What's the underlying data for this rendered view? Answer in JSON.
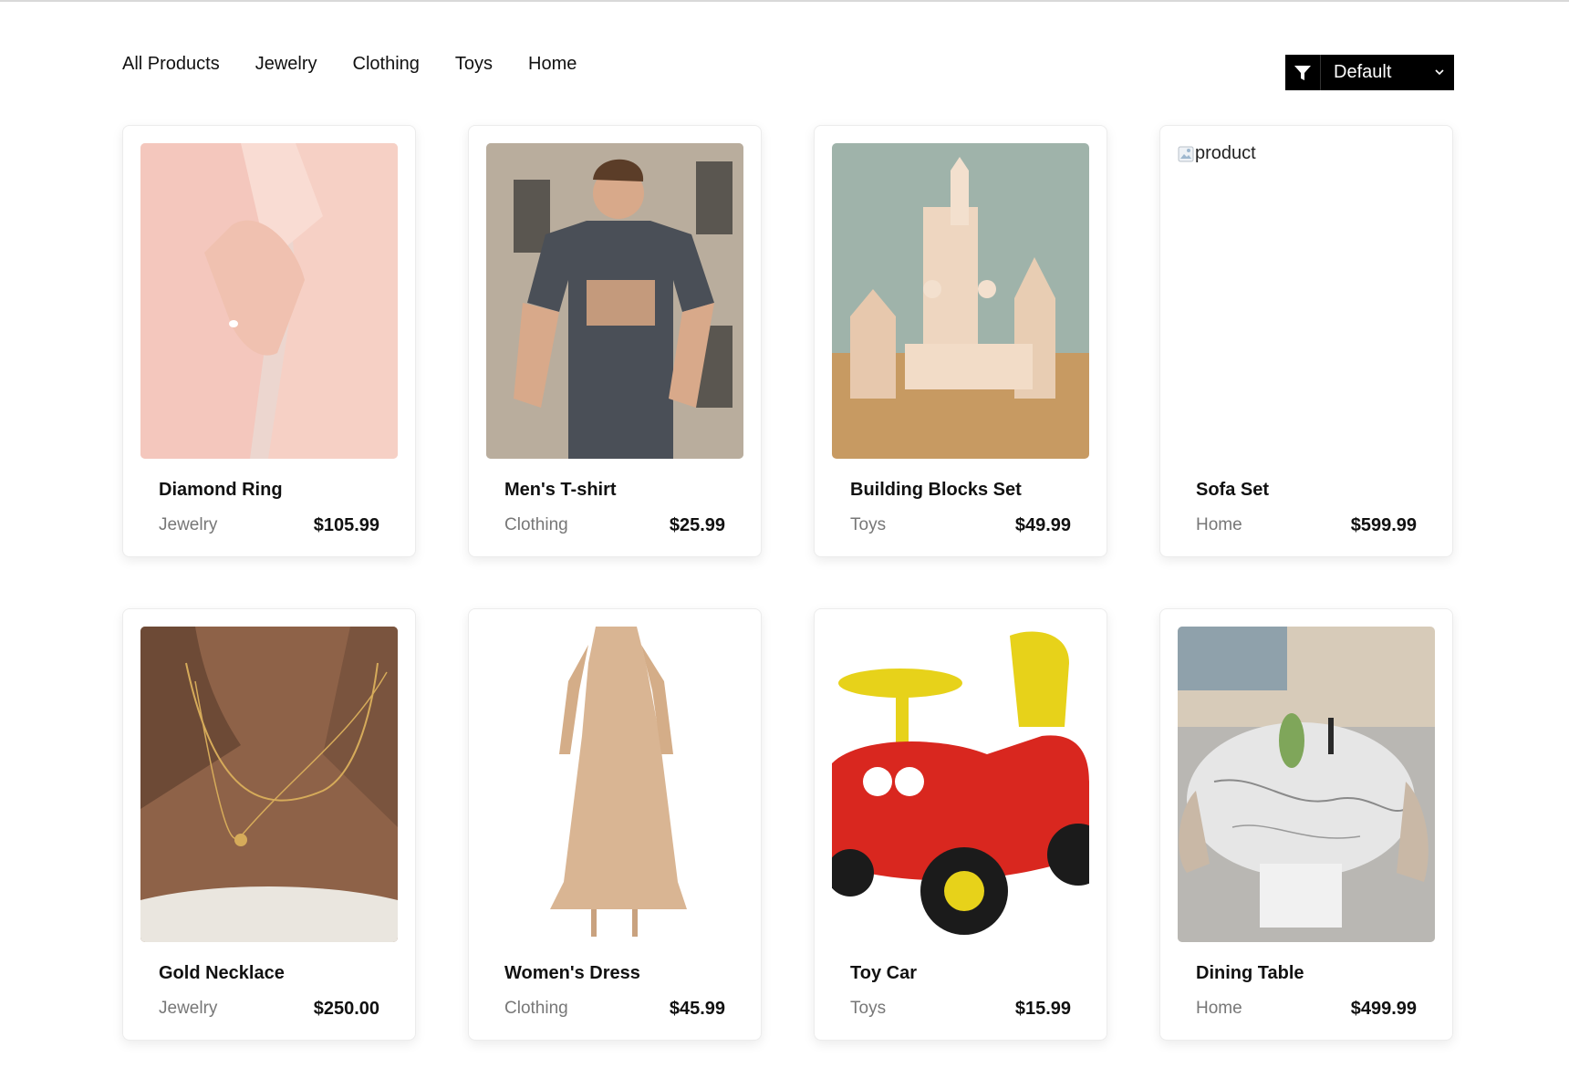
{
  "nav": {
    "items": [
      "All Products",
      "Jewelry",
      "Clothing",
      "Toys",
      "Home"
    ]
  },
  "sort": {
    "selected": "Default",
    "icon": "filter-icon"
  },
  "products": [
    {
      "name": "Diamond Ring",
      "category": "Jewelry",
      "price": "$105.99",
      "image": "ring-photo"
    },
    {
      "name": "Men's T-shirt",
      "category": "Clothing",
      "price": "$25.99",
      "image": "tshirt-photo"
    },
    {
      "name": "Building Blocks Set",
      "category": "Toys",
      "price": "$49.99",
      "image": "blocks-photo"
    },
    {
      "name": "Sofa Set",
      "category": "Home",
      "price": "$599.99",
      "image_alt": "product"
    },
    {
      "name": "Gold Necklace",
      "category": "Jewelry",
      "price": "$250.00",
      "image": "necklace-photo"
    },
    {
      "name": "Women's Dress",
      "category": "Clothing",
      "price": "$45.99",
      "image": "dress-photo"
    },
    {
      "name": "Toy Car",
      "category": "Toys",
      "price": "$15.99",
      "image": "toycar-photo"
    },
    {
      "name": "Dining Table",
      "category": "Home",
      "price": "$499.99",
      "image": "table-photo"
    }
  ]
}
